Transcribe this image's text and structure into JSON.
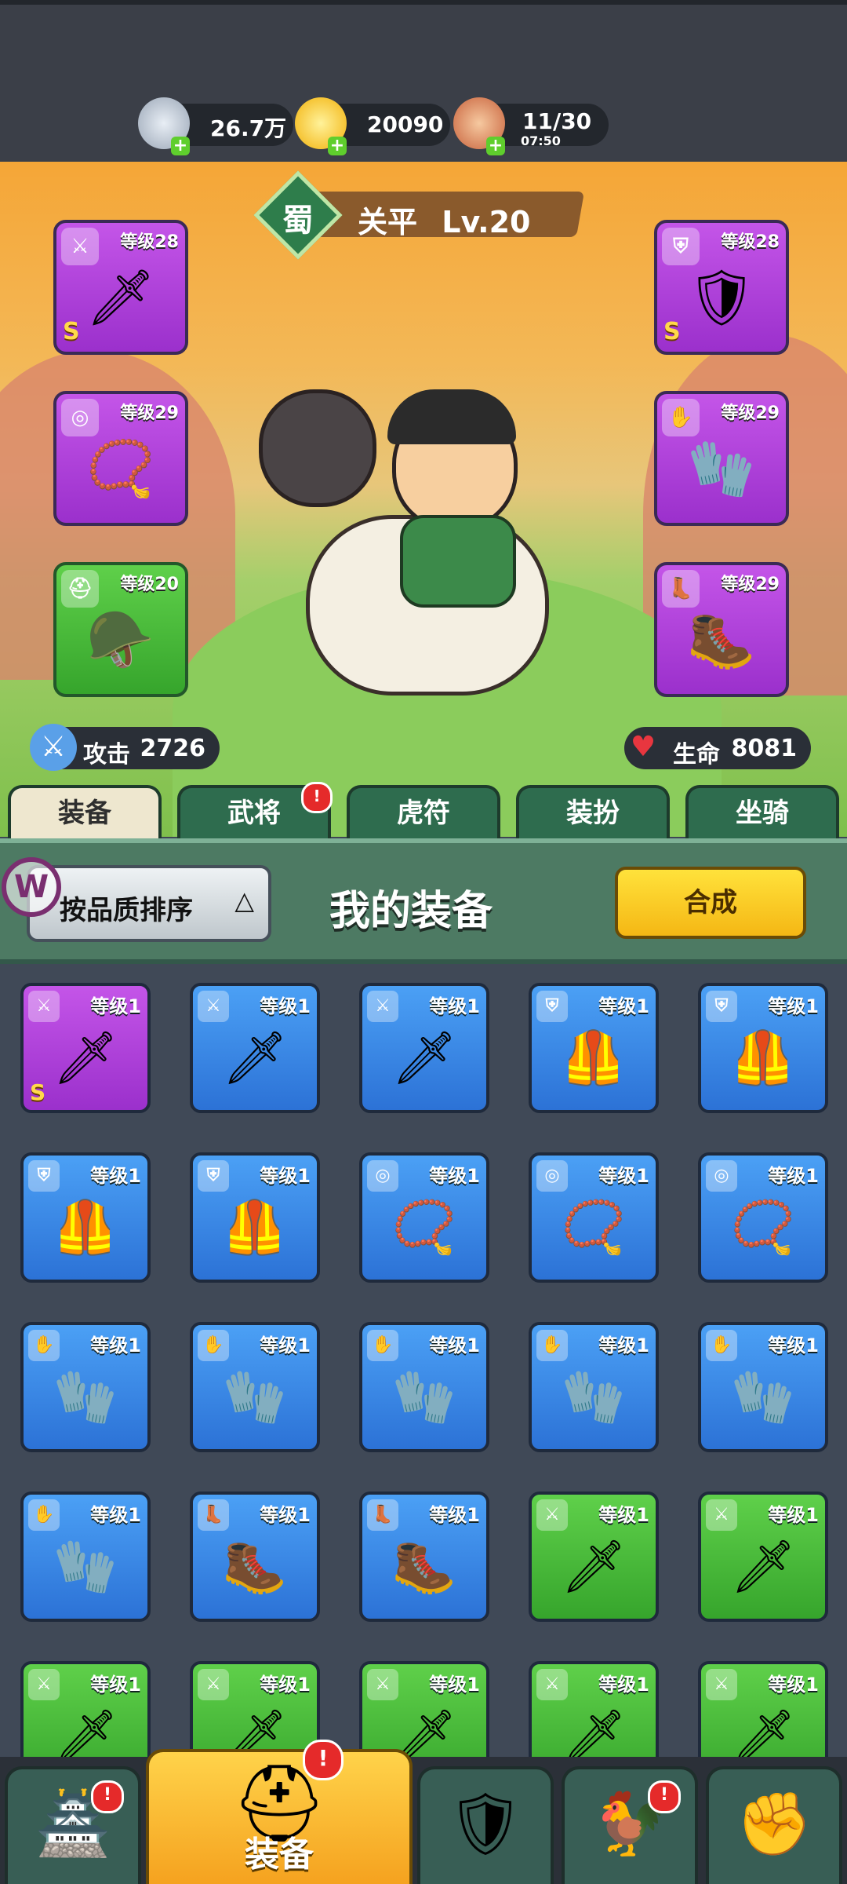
{
  "resources": [
    {
      "name": "silver-coin",
      "value": "26.7万",
      "sub": ""
    },
    {
      "name": "gold-ingot",
      "value": "20090",
      "sub": ""
    },
    {
      "name": "meat-stamina",
      "value": "11/30",
      "sub": "07:50"
    }
  ],
  "hero": {
    "faction": "蜀",
    "name": "关平",
    "level": "Lv.20",
    "attack_label": "攻击",
    "attack_value": "2726",
    "hp_label": "生命",
    "hp_value": "8081"
  },
  "equipped": [
    {
      "slot": "weapon",
      "level": "等级28",
      "rarity": "S",
      "color": "purple"
    },
    {
      "slot": "amulet",
      "level": "等级29",
      "rarity": "",
      "color": "purple"
    },
    {
      "slot": "helmet",
      "level": "等级20",
      "rarity": "",
      "color": "green"
    },
    {
      "slot": "armor",
      "level": "等级28",
      "rarity": "S",
      "color": "purple"
    },
    {
      "slot": "gloves",
      "level": "等级29",
      "rarity": "",
      "color": "purple"
    },
    {
      "slot": "boots",
      "level": "等级29",
      "rarity": "",
      "color": "purple"
    }
  ],
  "tabs": [
    "装备",
    "武将",
    "虎符",
    "装扮",
    "坐骑"
  ],
  "tabs_badge": "!",
  "panel": {
    "sort_label": "按品质排序",
    "sort_arrow": "△",
    "title": "我的装备",
    "combine_label": "合成"
  },
  "inventory_level": "等级1",
  "inventory": [
    {
      "type": "weapon",
      "color": "purple",
      "rarity": "S"
    },
    {
      "type": "weapon",
      "color": "blue",
      "rarity": ""
    },
    {
      "type": "weapon",
      "color": "blue",
      "rarity": ""
    },
    {
      "type": "armor",
      "color": "blue",
      "rarity": ""
    },
    {
      "type": "armor",
      "color": "blue",
      "rarity": ""
    },
    {
      "type": "armor",
      "color": "blue",
      "rarity": ""
    },
    {
      "type": "armor",
      "color": "blue",
      "rarity": ""
    },
    {
      "type": "amulet",
      "color": "blue",
      "rarity": ""
    },
    {
      "type": "amulet",
      "color": "blue",
      "rarity": ""
    },
    {
      "type": "amulet",
      "color": "blue",
      "rarity": ""
    },
    {
      "type": "gloves",
      "color": "blue",
      "rarity": ""
    },
    {
      "type": "gloves",
      "color": "blue",
      "rarity": ""
    },
    {
      "type": "gloves",
      "color": "blue",
      "rarity": ""
    },
    {
      "type": "gloves",
      "color": "blue",
      "rarity": ""
    },
    {
      "type": "gloves",
      "color": "blue",
      "rarity": ""
    },
    {
      "type": "gloves",
      "color": "blue",
      "rarity": ""
    },
    {
      "type": "boots",
      "color": "blue",
      "rarity": ""
    },
    {
      "type": "boots",
      "color": "blue",
      "rarity": ""
    },
    {
      "type": "weapon",
      "color": "green",
      "rarity": ""
    },
    {
      "type": "weapon",
      "color": "green",
      "rarity": ""
    },
    {
      "type": "weapon",
      "color": "green",
      "rarity": ""
    },
    {
      "type": "weapon",
      "color": "green",
      "rarity": ""
    },
    {
      "type": "weapon",
      "color": "green",
      "rarity": ""
    },
    {
      "type": "weapon",
      "color": "green",
      "rarity": ""
    },
    {
      "type": "weapon",
      "color": "green",
      "rarity": ""
    }
  ],
  "bottom_nav": [
    {
      "name": "castle",
      "label": "",
      "badge": "!"
    },
    {
      "name": "equipment",
      "label": "装备",
      "badge": "!"
    },
    {
      "name": "battle",
      "label": "",
      "badge": ""
    },
    {
      "name": "summon",
      "label": "",
      "badge": "!"
    },
    {
      "name": "upgrade",
      "label": "",
      "badge": ""
    }
  ],
  "colors": {
    "purple": "#a63bd6",
    "blue": "#3380e0",
    "green": "#47b93a",
    "accent_yellow": "#f8c91f"
  }
}
